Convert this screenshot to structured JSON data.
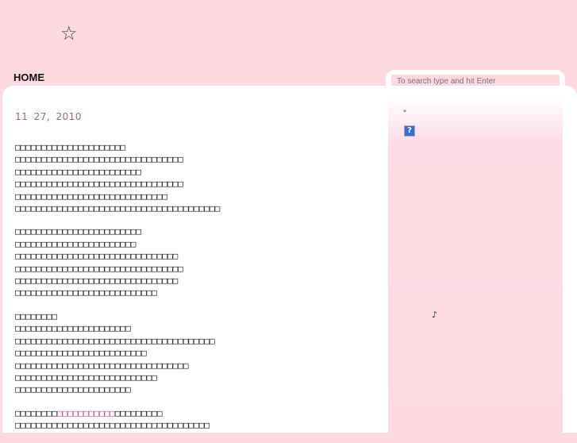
{
  "header": {
    "logo_glyph": "☆",
    "nav_home": "HOME"
  },
  "search": {
    "placeholder": "To search type and hit Enter"
  },
  "post": {
    "date": "11  27, 2010",
    "paragraph1": "□□□□□□□□□□□□□□□□□□□□□\n□□□□□□□□□□□□□□□□□□□□□□□□□□□□□□□□\n□□□□□□□□□□□□□□□□□□□□□□□□\n□□□□□□□□□□□□□□□□□□□□□□□□□□□□□□□□\n□□□□□□□□□□□□□□□□□□□□□□□□□□□□□\n□□□□□□□□□□□□□□□□□□□□□□□□□□□□□□□□□□□□□□□",
    "paragraph2": "□□□□□□□□□□□□□□□□□□□□□□□□\n□□□□□□□□□□□□□□□□□□□□□□□\n□□□□□□□□□□□□□□□□□□□□□□□□□□□□□□□\n□□□□□□□□□□□□□□□□□□□□□□□□□□□□□□□□\n□□□□□□□□□□□□□□□□□□□□□□□□□□□□□□□\n□□□□□□□□□□□□□□□□□□□□□□□□□□□",
    "paragraph3": "□□□□□□□□\n□□□□□□□□□□□□□□□□□□□□□□\n□□□□□□□□□□□□□□□□□□□□□□□□□□□□□□□□□□□□□□\n□□□□□□□□□□□□□□□□□□□□□□□□□\n□□□□□□□□□□□□□□□□□□□□□□□□□□□□□□□□□\n□□□□□□□□□□□□□□□□□□□□□□□□□□□\n□□□□□□□□□□□□□□□□□□□□□□",
    "paragraph4_prefix": "□□□□□□□□",
    "paragraph4_link": "□□□□□□□□□□□",
    "paragraph4_suffix": "□□□□□□□□□",
    "paragraph4_line2": "□□□□□□□□□□□□□□□□□□□□□□□□□□□□□□□□□□□□□"
  },
  "sidebar": {
    "quote_mark": "\"",
    "help_icon_label": "?",
    "music_note": "♪"
  },
  "colors": {
    "page_bg": "#ffd9e2",
    "date_color": "#a0608a",
    "link_color": "#b04a8c"
  }
}
